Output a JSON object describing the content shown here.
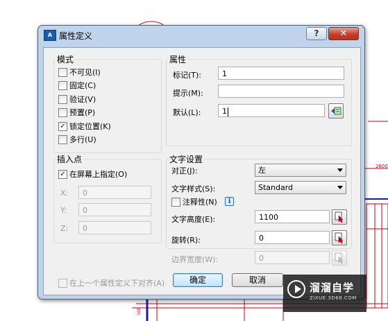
{
  "dialog": {
    "title": "属性定义",
    "help_label": "?",
    "close_label": "✕"
  },
  "mode": {
    "title": "模式",
    "items": [
      {
        "label": "不可见(I)",
        "checked": false
      },
      {
        "label": "固定(C)",
        "checked": false
      },
      {
        "label": "验证(V)",
        "checked": false
      },
      {
        "label": "预置(P)",
        "checked": false
      },
      {
        "label": "锁定位置(K)",
        "checked": true
      },
      {
        "label": "多行(U)",
        "checked": false
      }
    ]
  },
  "insertion": {
    "title": "插入点",
    "specify_on_screen": {
      "label": "在屏幕上指定(O)",
      "checked": true
    },
    "x_label": "X:",
    "x_value": "0",
    "y_label": "Y:",
    "y_value": "0",
    "z_label": "Z:",
    "z_value": "0"
  },
  "attribute": {
    "title": "属性",
    "tag_label": "标记(T):",
    "tag_value": "1",
    "prompt_label": "提示(M):",
    "prompt_value": "",
    "default_label": "默认(L):",
    "default_value": "1"
  },
  "text_settings": {
    "title": "文字设置",
    "justify_label": "对正(J):",
    "justify_value": "左",
    "style_label": "文字样式(S):",
    "style_value": "Standard",
    "annotative_label": "注释性(N)",
    "annotative_checked": false,
    "info_icon": "i",
    "height_label": "文字高度(E):",
    "height_value": "1100",
    "rotation_label": "旋转(R):",
    "rotation_value": "0",
    "boundary_label": "边界宽度(W):",
    "boundary_value": "0"
  },
  "align_below": {
    "label": "在上一个属性定义下对齐(A)",
    "checked": false
  },
  "buttons": {
    "ok": "确定",
    "cancel": "取消"
  },
  "watermark": {
    "name": "溜溜自学",
    "url": "ZIXUE.3D66.COM"
  },
  "background": {
    "dimension_text": "2600",
    "side_number": "100"
  },
  "colors": {
    "cad_red": "#c4001a",
    "cad_blue": "#1a1aa8",
    "dialog_frame": "#bfd3ea"
  }
}
